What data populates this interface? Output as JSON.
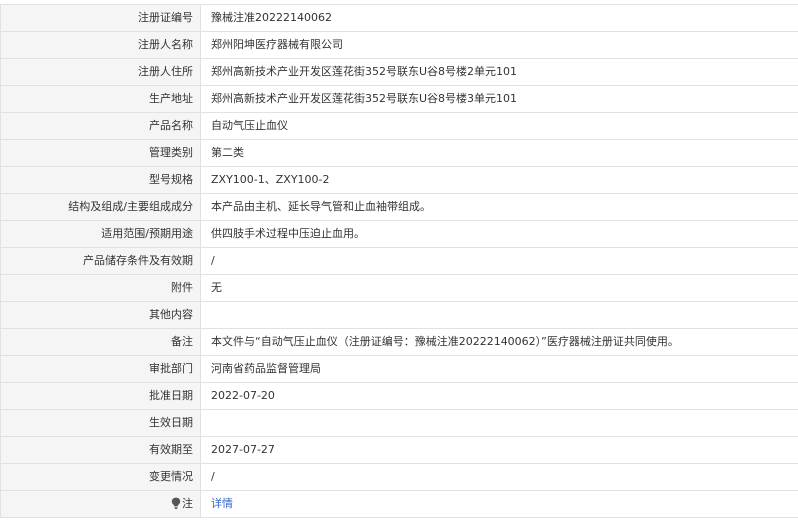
{
  "rows": [
    {
      "label": "注册证编号",
      "value": "豫械注准20222140062"
    },
    {
      "label": "注册人名称",
      "value": "郑州阳坤医疗器械有限公司"
    },
    {
      "label": "注册人住所",
      "value": "郑州高新技术产业开发区莲花街352号联东U谷8号楼2单元101"
    },
    {
      "label": "生产地址",
      "value": "郑州高新技术产业开发区莲花街352号联东U谷8号楼3单元101"
    },
    {
      "label": "产品名称",
      "value": "自动气压止血仪"
    },
    {
      "label": "管理类别",
      "value": "第二类"
    },
    {
      "label": "型号规格",
      "value": "ZXY100-1、ZXY100-2"
    },
    {
      "label": "结构及组成/主要组成成分",
      "value": "本产品由主机、延长导气管和止血袖带组成。"
    },
    {
      "label": "适用范围/预期用途",
      "value": "供四肢手术过程中压迫止血用。"
    },
    {
      "label": "产品储存条件及有效期",
      "value": "/"
    },
    {
      "label": "附件",
      "value": "无"
    },
    {
      "label": "其他内容",
      "value": ""
    },
    {
      "label": "备注",
      "value": "本文件与“自动气压止血仪（注册证编号：豫械注准20222140062）”医疗器械注册证共同使用。"
    },
    {
      "label": "审批部门",
      "value": "河南省药品监督管理局"
    },
    {
      "label": "批准日期",
      "value": "2022-07-20"
    },
    {
      "label": "生效日期",
      "value": ""
    },
    {
      "label": "有效期至",
      "value": "2027-07-27"
    },
    {
      "label": "变更情况",
      "value": "/"
    }
  ],
  "note_row": {
    "label": "注",
    "link_text": "详情",
    "icon": "lightbulb-icon"
  },
  "colors": {
    "label_bg": "#f5f5f5",
    "border": "#e1e1e1",
    "text": "#333333",
    "link": "#3366cc"
  }
}
